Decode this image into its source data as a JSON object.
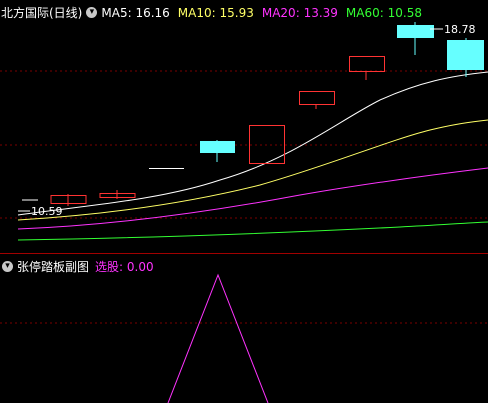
{
  "main_chart": {
    "title": "北方国际(日线)",
    "indicators": [
      {
        "name": "MA5",
        "value": "16.16",
        "color": "#ffffff"
      },
      {
        "name": "MA10",
        "value": "15.93",
        "color": "#ffff66"
      },
      {
        "name": "MA20",
        "value": "13.39",
        "color": "#ff33ff"
      },
      {
        "name": "MA60",
        "value": "10.58",
        "color": "#33ff33"
      }
    ],
    "high_label": "18.78",
    "low_label": "10.59",
    "colors": {
      "up": "#ff3333",
      "down": "#66ffff",
      "flat": "#ffffff"
    }
  },
  "sub_chart": {
    "title": "张停踏板副图",
    "indicator_name": "选股",
    "indicator_value": "0.00",
    "indicator_color": "#ff33ff"
  }
}
